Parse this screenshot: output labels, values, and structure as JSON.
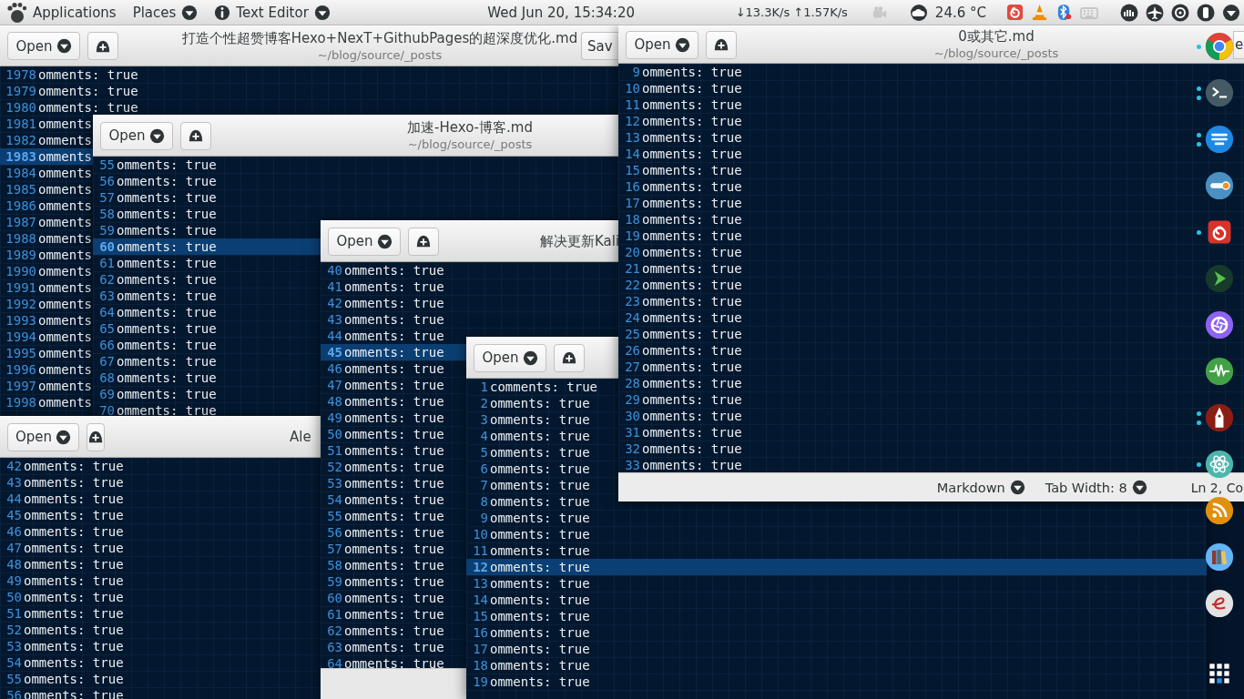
{
  "top_bar": {
    "menus": [
      {
        "label": "Applications",
        "kind": "menu",
        "dropdown": false
      },
      {
        "label": "Places",
        "kind": "menu",
        "dropdown": true
      },
      {
        "label": "Text Editor",
        "kind": "app",
        "dropdown": true
      }
    ],
    "clock": "Wed Jun 20, 15:34:20",
    "network_speed": "↓13.3K/s ↑1.57K/s",
    "temperature": "24.6 °C"
  },
  "windows": [
    {
      "open_button": "Open",
      "title": "打造个性超赞博客Hexo+NexT+GithubPages的超深度优化.md",
      "subtitle": "~/blog/source/_posts",
      "save_button": "Sav",
      "lines": [
        {
          "number": "1978",
          "text": "omments: true",
          "selected": false
        },
        {
          "number": "1979",
          "text": "omments: true",
          "selected": false
        },
        {
          "number": "1980",
          "text": "omments: true",
          "selected": false
        },
        {
          "number": "1981",
          "text": "omments",
          "selected": false
        },
        {
          "number": "1982",
          "text": "omments",
          "selected": false
        },
        {
          "number": "1983",
          "text": "omments",
          "selected": true
        },
        {
          "number": "1984",
          "text": "omments",
          "selected": false
        },
        {
          "number": "1985",
          "text": "omments",
          "selected": false
        },
        {
          "number": "1986",
          "text": "omments",
          "selected": false
        },
        {
          "number": "1987",
          "text": "omments",
          "selected": false
        },
        {
          "number": "1988",
          "text": "omments",
          "selected": false
        },
        {
          "number": "1989",
          "text": "omments",
          "selected": false
        },
        {
          "number": "1990",
          "text": "omments",
          "selected": false
        },
        {
          "number": "1991",
          "text": "omments",
          "selected": false
        },
        {
          "number": "1992",
          "text": "omments",
          "selected": false
        },
        {
          "number": "1993",
          "text": "omments",
          "selected": false
        },
        {
          "number": "1994",
          "text": "omments",
          "selected": false
        },
        {
          "number": "1995",
          "text": "omments",
          "selected": false
        },
        {
          "number": "1996",
          "text": "omments",
          "selected": false
        },
        {
          "number": "1997",
          "text": "omments",
          "selected": false
        },
        {
          "number": "1998",
          "text": "omments",
          "selected": false
        }
      ]
    },
    {
      "open_button": "Open",
      "title": "加速-Hexo-博客.md",
      "subtitle": "~/blog/source/_posts",
      "lines": [
        {
          "number": "55",
          "text": "omments: true",
          "selected": false
        },
        {
          "number": "56",
          "text": "omments: true",
          "selected": false
        },
        {
          "number": "57",
          "text": "omments: true",
          "selected": false
        },
        {
          "number": "58",
          "text": "omments: true",
          "selected": false
        },
        {
          "number": "59",
          "text": "omments: true",
          "selected": false
        },
        {
          "number": "60",
          "text": "omments: true",
          "selected": true
        },
        {
          "number": "61",
          "text": "omments: true",
          "selected": false
        },
        {
          "number": "62",
          "text": "omments: true",
          "selected": false
        },
        {
          "number": "63",
          "text": "omments: true",
          "selected": false
        },
        {
          "number": "64",
          "text": "omments: true",
          "selected": false
        },
        {
          "number": "65",
          "text": "omments: true",
          "selected": false
        },
        {
          "number": "66",
          "text": "omments: true",
          "selected": false
        },
        {
          "number": "67",
          "text": "omments: true",
          "selected": false
        },
        {
          "number": "68",
          "text": "omments: true",
          "selected": false
        },
        {
          "number": "69",
          "text": "omments: true",
          "selected": false
        },
        {
          "number": "70",
          "text": "omments: true",
          "selected": false
        }
      ]
    },
    {
      "open_button": "Open",
      "title": "Ale",
      "lines": [
        {
          "number": "42",
          "text": "omments: true",
          "selected": false
        },
        {
          "number": "43",
          "text": "omments: true",
          "selected": false
        },
        {
          "number": "44",
          "text": "omments: true",
          "selected": false
        },
        {
          "number": "45",
          "text": "omments: true",
          "selected": false
        },
        {
          "number": "46",
          "text": "omments: true",
          "selected": false
        },
        {
          "number": "47",
          "text": "omments: true",
          "selected": false
        },
        {
          "number": "48",
          "text": "omments: true",
          "selected": false
        },
        {
          "number": "49",
          "text": "omments: true",
          "selected": false
        },
        {
          "number": "50",
          "text": "omments: true",
          "selected": false
        },
        {
          "number": "51",
          "text": "omments: true",
          "selected": false
        },
        {
          "number": "52",
          "text": "omments: true",
          "selected": false
        },
        {
          "number": "53",
          "text": "omments: true",
          "selected": false
        },
        {
          "number": "54",
          "text": "omments: true",
          "selected": false
        },
        {
          "number": "55",
          "text": "omments: true",
          "selected": false
        },
        {
          "number": "56",
          "text": "omments: true",
          "selected": false
        }
      ]
    },
    {
      "open_button": "Open",
      "title": "解决更新Kali",
      "lines": [
        {
          "number": "40",
          "text": "omments: true",
          "selected": false
        },
        {
          "number": "41",
          "text": "omments: true",
          "selected": false
        },
        {
          "number": "42",
          "text": "omments: true",
          "selected": false
        },
        {
          "number": "43",
          "text": "omments: true",
          "selected": false
        },
        {
          "number": "44",
          "text": "omments: true",
          "selected": false
        },
        {
          "number": "45",
          "text": "omments: true",
          "selected": true
        },
        {
          "number": "46",
          "text": "omments: true",
          "selected": false
        },
        {
          "number": "47",
          "text": "omments: true",
          "selected": false
        },
        {
          "number": "48",
          "text": "omments: true",
          "selected": false
        },
        {
          "number": "49",
          "text": "omments: true",
          "selected": false
        },
        {
          "number": "50",
          "text": "omments: true",
          "selected": false
        },
        {
          "number": "51",
          "text": "omments: true",
          "selected": false
        },
        {
          "number": "52",
          "text": "omments: true",
          "selected": false
        },
        {
          "number": "53",
          "text": "omments: true",
          "selected": false
        },
        {
          "number": "54",
          "text": "omments: true",
          "selected": false
        },
        {
          "number": "55",
          "text": "omments: true",
          "selected": false
        },
        {
          "number": "56",
          "text": "omments: true",
          "selected": false
        },
        {
          "number": "57",
          "text": "omments: true",
          "selected": false
        },
        {
          "number": "58",
          "text": "omments: true",
          "selected": false
        },
        {
          "number": "59",
          "text": "omments: true",
          "selected": false
        },
        {
          "number": "60",
          "text": "omments: true",
          "selected": false
        },
        {
          "number": "61",
          "text": "omments: true",
          "selected": false
        },
        {
          "number": "62",
          "text": "omments: true",
          "selected": false
        },
        {
          "number": "63",
          "text": "omments: true",
          "selected": false
        },
        {
          "number": "64",
          "text": "omments: true",
          "selected": false
        }
      ]
    },
    {
      "open_button": "Open",
      "lines": [
        {
          "number": "1",
          "text": "comments: true",
          "selected": false
        },
        {
          "number": "2",
          "text": "omments: true",
          "selected": false
        },
        {
          "number": "3",
          "text": "omments: true",
          "selected": false
        },
        {
          "number": "4",
          "text": "omments: true",
          "selected": false
        },
        {
          "number": "5",
          "text": "omments: true",
          "selected": false
        },
        {
          "number": "6",
          "text": "omments: true",
          "selected": false
        },
        {
          "number": "7",
          "text": "omments: true",
          "selected": false
        },
        {
          "number": "8",
          "text": "omments: true",
          "selected": false
        },
        {
          "number": "9",
          "text": "omments: true",
          "selected": false
        },
        {
          "number": "10",
          "text": "omments: true",
          "selected": false
        },
        {
          "number": "11",
          "text": "omments: true",
          "selected": false
        },
        {
          "number": "12",
          "text": "omments: true",
          "selected": true
        },
        {
          "number": "13",
          "text": "omments: true",
          "selected": false
        },
        {
          "number": "14",
          "text": "omments: true",
          "selected": false
        },
        {
          "number": "15",
          "text": "omments: true",
          "selected": false
        },
        {
          "number": "16",
          "text": "omments: true",
          "selected": false
        },
        {
          "number": "17",
          "text": "omments: true",
          "selected": false
        },
        {
          "number": "18",
          "text": "omments: true",
          "selected": false
        },
        {
          "number": "19",
          "text": "omments: true",
          "selected": false
        }
      ]
    },
    {
      "open_button": "Open",
      "title": "0或其它.md",
      "subtitle": "~/blog/source/_posts",
      "save_button": "e",
      "lines": [
        {
          "number": "9",
          "text": "omments: true",
          "selected": false
        },
        {
          "number": "10",
          "text": "omments: true",
          "selected": false
        },
        {
          "number": "11",
          "text": "omments: true",
          "selected": false
        },
        {
          "number": "12",
          "text": "omments: true",
          "selected": false
        },
        {
          "number": "13",
          "text": "omments: true",
          "selected": false
        },
        {
          "number": "14",
          "text": "omments: true",
          "selected": false
        },
        {
          "number": "15",
          "text": "omments: true",
          "selected": false
        },
        {
          "number": "16",
          "text": "omments: true",
          "selected": false
        },
        {
          "number": "17",
          "text": "omments: true",
          "selected": false
        },
        {
          "number": "18",
          "text": "omments: true",
          "selected": false
        },
        {
          "number": "19",
          "text": "omments: true",
          "selected": false
        },
        {
          "number": "20",
          "text": "omments: true",
          "selected": false
        },
        {
          "number": "21",
          "text": "omments: true",
          "selected": false
        },
        {
          "number": "22",
          "text": "omments: true",
          "selected": false
        },
        {
          "number": "23",
          "text": "omments: true",
          "selected": false
        },
        {
          "number": "24",
          "text": "omments: true",
          "selected": false
        },
        {
          "number": "25",
          "text": "omments: true",
          "selected": false
        },
        {
          "number": "26",
          "text": "omments: true",
          "selected": false
        },
        {
          "number": "27",
          "text": "omments: true",
          "selected": false
        },
        {
          "number": "28",
          "text": "omments: true",
          "selected": false
        },
        {
          "number": "29",
          "text": "omments: true",
          "selected": false
        },
        {
          "number": "30",
          "text": "omments: true",
          "selected": false
        },
        {
          "number": "31",
          "text": "omments: true",
          "selected": false
        },
        {
          "number": "32",
          "text": "omments: true",
          "selected": false
        },
        {
          "number": "33",
          "text": "omments: true",
          "selected": false
        }
      ],
      "status_bar": {
        "language": "Markdown",
        "tab_width": "Tab Width: 8",
        "position": "Ln 2, Co"
      }
    }
  ],
  "dock": [
    {
      "kind": "browser",
      "running": true,
      "multiple_windows": false
    },
    {
      "kind": "terminal",
      "running": true,
      "multiple_windows": true
    },
    {
      "kind": "lines",
      "running": true,
      "multiple_windows": true
    },
    {
      "kind": "toggle",
      "running": false,
      "multiple_windows": false
    },
    {
      "kind": "spiral",
      "running": true,
      "multiple_windows": false
    },
    {
      "kind": "chevron",
      "running": false,
      "multiple_windows": false
    },
    {
      "kind": "aperture",
      "running": false,
      "multiple_windows": false
    },
    {
      "kind": "pulse",
      "running": false,
      "multiple_windows": false
    },
    {
      "kind": "nib",
      "running": true,
      "multiple_windows": true
    },
    {
      "kind": "atom",
      "running": true,
      "multiple_windows": false
    },
    {
      "kind": "rss",
      "running": false,
      "multiple_windows": false
    },
    {
      "kind": "books",
      "running": false,
      "multiple_windows": false
    },
    {
      "kind": "curl",
      "running": false,
      "multiple_windows": false
    },
    {
      "kind": "grid",
      "running": false,
      "multiple_windows": false
    }
  ]
}
